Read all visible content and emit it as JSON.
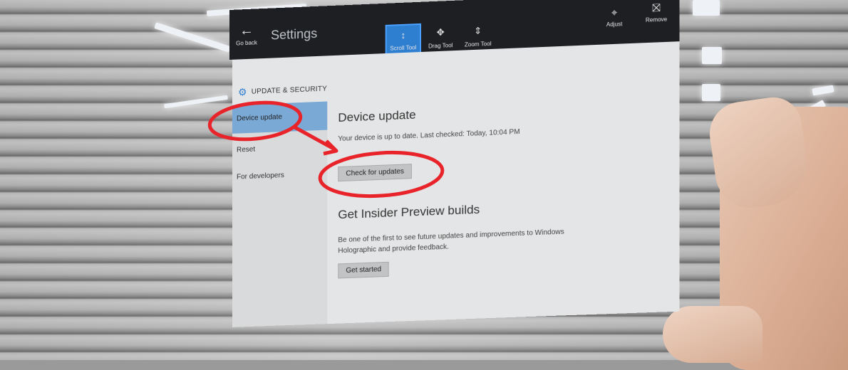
{
  "appbar": {
    "back_label": "Go back",
    "title": "Settings",
    "tools": [
      {
        "label": "Scroll Tool",
        "icon": "scroll-icon",
        "active": true
      },
      {
        "label": "Drag Tool",
        "icon": "drag-icon",
        "active": false
      },
      {
        "label": "Zoom Tool",
        "icon": "zoom-icon",
        "active": false
      }
    ],
    "right_tools": [
      {
        "label": "Adjust",
        "icon": "adjust-icon"
      },
      {
        "label": "Remove",
        "icon": "remove-icon"
      }
    ]
  },
  "section": {
    "title": "UPDATE & SECURITY",
    "icon": "gear-icon"
  },
  "sidebar": {
    "items": [
      {
        "label": "Device update",
        "selected": true
      },
      {
        "label": "Reset",
        "selected": false
      },
      {
        "label": "For developers",
        "selected": false
      }
    ]
  },
  "main": {
    "device_update_title": "Device update",
    "status_text": "Your device is up to date. Last checked: Today, 10:04 PM",
    "check_button": "Check for updates",
    "insider_title": "Get Insider Preview builds",
    "insider_desc": "Be one of the first to see future updates and improvements to Windows Holographic and provide feedback.",
    "get_started_button": "Get started"
  },
  "colors": {
    "accent": "#2f7fd1",
    "annotation": "#e8232a"
  }
}
